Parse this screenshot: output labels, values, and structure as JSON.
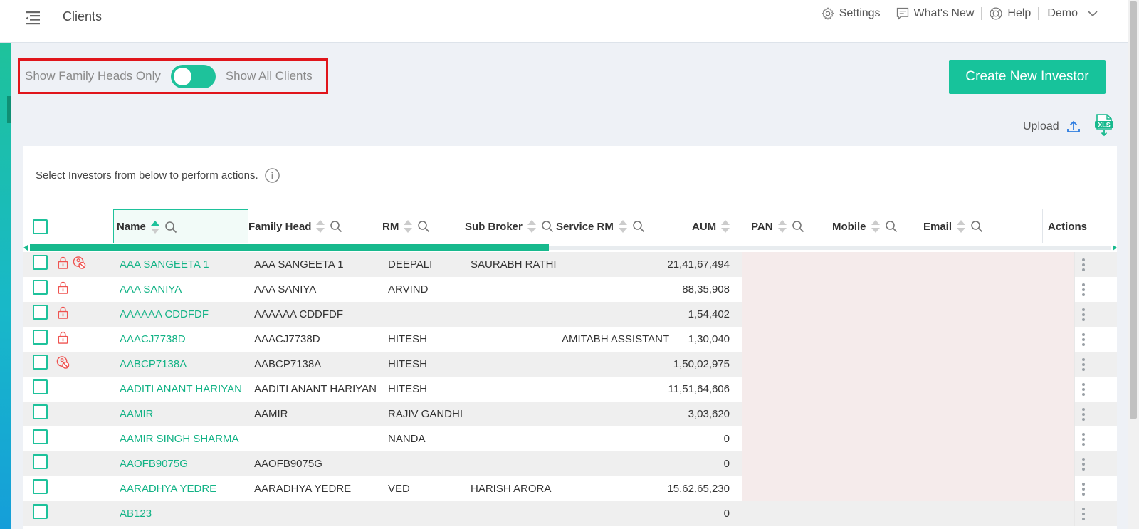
{
  "header": {
    "title": "Clients",
    "links": [
      {
        "label": "Settings",
        "icon": "gear-icon"
      },
      {
        "label": "What's New",
        "icon": "chat-icon"
      },
      {
        "label": "Help",
        "icon": "lifebuoy-icon"
      }
    ],
    "user": "Demo"
  },
  "filter": {
    "left_label": "Show Family Heads Only",
    "right_label": "Show All Clients",
    "toggle_on": true
  },
  "create_button": "Create New Investor",
  "upload_label": "Upload",
  "hint": "Select Investors from below to perform actions.",
  "columns": {
    "name": "Name",
    "family_head": "Family Head",
    "rm": "RM",
    "sub_broker": "Sub Broker",
    "service_rm": "Service RM",
    "aum": "AUM",
    "pan": "PAN",
    "mobile": "Mobile",
    "email": "Email",
    "actions": "Actions"
  },
  "rows": [
    {
      "name": "AAA SANGEETA 1",
      "family_head": "AAA SANGEETA 1",
      "rm": "DEEPALI",
      "sub_broker": "SAURABH RATHI",
      "service_rm": "",
      "aum": "21,41,67,494",
      "icons": [
        "lock",
        "blocked"
      ]
    },
    {
      "name": "AAA SANIYA",
      "family_head": "AAA SANIYA",
      "rm": "ARVIND",
      "sub_broker": "",
      "service_rm": "",
      "aum": "88,35,908",
      "icons": [
        "lock"
      ]
    },
    {
      "name": "AAAAAA CDDFDF",
      "family_head": "AAAAAA CDDFDF",
      "rm": "",
      "sub_broker": "",
      "service_rm": "",
      "aum": "1,54,402",
      "icons": [
        "lock"
      ]
    },
    {
      "name": "AAACJ7738D",
      "family_head": "AAACJ7738D",
      "rm": "HITESH",
      "sub_broker": "",
      "service_rm": "AMITABH ASSISTANT",
      "aum": "1,30,040",
      "icons": [
        "lock"
      ]
    },
    {
      "name": "AABCP7138A",
      "family_head": "AABCP7138A",
      "rm": "HITESH",
      "sub_broker": "",
      "service_rm": "",
      "aum": "1,50,02,975",
      "icons": [
        "blocked"
      ]
    },
    {
      "name": "AADITI ANANT HARIYAN",
      "family_head": "AADITI ANANT HARIYAN",
      "rm": "HITESH",
      "sub_broker": "",
      "service_rm": "",
      "aum": "11,51,64,606",
      "icons": []
    },
    {
      "name": "AAMIR",
      "family_head": "AAMIR",
      "rm": "RAJIV GANDHI",
      "sub_broker": "",
      "service_rm": "",
      "aum": "3,03,620",
      "icons": []
    },
    {
      "name": "AAMIR SINGH SHARMA",
      "family_head": "",
      "rm": "NANDA",
      "sub_broker": "",
      "service_rm": "",
      "aum": "0",
      "icons": []
    },
    {
      "name": "AAOFB9075G",
      "family_head": "AAOFB9075G",
      "rm": "",
      "sub_broker": "",
      "service_rm": "",
      "aum": "0",
      "icons": []
    },
    {
      "name": "AARADHYA YEDRE",
      "family_head": "AARADHYA YEDRE",
      "rm": "VED",
      "sub_broker": "HARISH ARORA",
      "service_rm": "",
      "aum": "15,62,65,230",
      "icons": []
    },
    {
      "name": "AB123",
      "family_head": "",
      "rm": "",
      "sub_broker": "",
      "service_rm": "",
      "aum": "0",
      "icons": []
    }
  ],
  "colors": {
    "accent": "#1ec29b",
    "link": "#13b386",
    "highlight_border": "#e0151b",
    "lock_icon": "#ef5350"
  }
}
